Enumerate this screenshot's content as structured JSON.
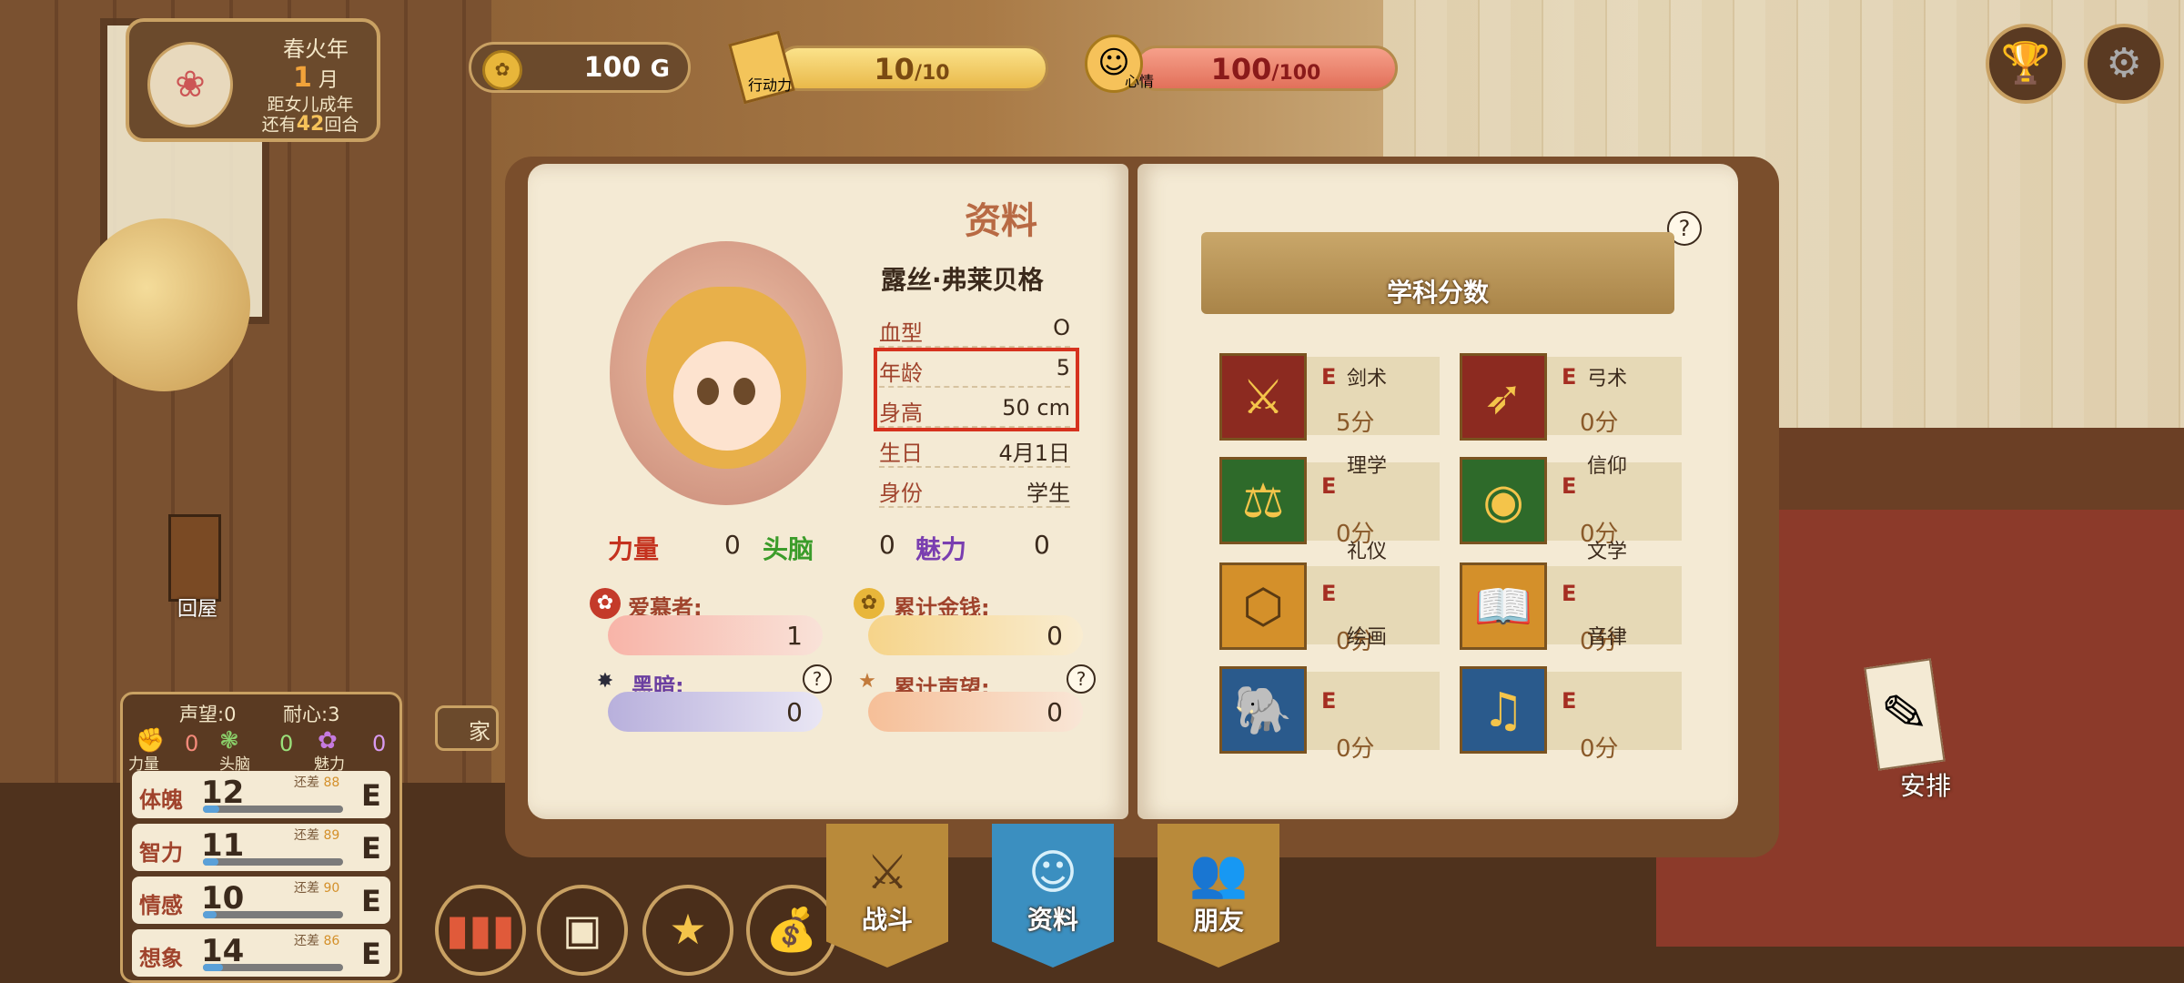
{
  "calendar": {
    "season": "春火年",
    "month_num": "1",
    "month_unit": "月",
    "line1": "距女儿成年",
    "line2_prefix": "还有",
    "rounds": "42",
    "line2_suffix": "回合"
  },
  "hud": {
    "gold": {
      "value": "100",
      "unit": "G"
    },
    "action": {
      "label": "行动力",
      "value": "10",
      "max": "/10",
      "fill": 1.0
    },
    "mood": {
      "label": "心情",
      "value": "100",
      "max": "/100",
      "fill": 1.0
    }
  },
  "buttons": {
    "trophy_icon": "trophy-icon",
    "settings_icon": "gear-icon",
    "back_home": "回屋",
    "home_tab": "家",
    "arrange": "安排"
  },
  "profile": {
    "title": "资料",
    "name": "露丝·弗莱贝格",
    "rows": [
      {
        "key": "血型",
        "value": "O"
      },
      {
        "key": "年龄",
        "value": "5"
      },
      {
        "key": "身高",
        "value": "50 cm"
      },
      {
        "key": "生日",
        "value": "4月1日"
      },
      {
        "key": "身份",
        "value": "学生"
      }
    ],
    "stats": [
      {
        "label": "力量",
        "value": "0",
        "color": "#c4321e"
      },
      {
        "label": "头脑",
        "value": "0",
        "color": "#3b9c2a"
      },
      {
        "label": "魅力",
        "value": "0",
        "color": "#7a3eb0"
      }
    ],
    "meters": [
      {
        "label": "爱慕者:",
        "value": "1",
        "color": "#f6c8bc",
        "icon": "rose-icon"
      },
      {
        "label": "累计金钱:",
        "value": "0",
        "color": "#f6dfae",
        "icon": "coin-icon"
      },
      {
        "label": "黑暗:",
        "value": "0",
        "color": "#cbc6e2",
        "icon": "dark-star-icon"
      },
      {
        "label": "累计声望:",
        "value": "0",
        "color": "#f6d2b6",
        "icon": "star-icon"
      }
    ]
  },
  "subjects": {
    "title": "学科分数",
    "items": [
      {
        "name": "剑术",
        "grade": "E",
        "score": "5分",
        "icon": "sword-icon",
        "color": "#8c2a20"
      },
      {
        "name": "弓术",
        "grade": "E",
        "score": "0分",
        "icon": "bow-icon",
        "color": "#8c2a20"
      },
      {
        "name": "理学",
        "grade": "E",
        "score": "0分",
        "icon": "scales-icon",
        "color": "#2e6a2a"
      },
      {
        "name": "信仰",
        "grade": "E",
        "score": "0分",
        "icon": "eye-icon",
        "color": "#2e6a2a"
      },
      {
        "name": "礼仪",
        "grade": "E",
        "score": "0分",
        "icon": "pendant-icon",
        "color": "#d4902a"
      },
      {
        "name": "文学",
        "grade": "E",
        "score": "0分",
        "icon": "book-icon",
        "color": "#d4902a"
      },
      {
        "name": "绘画",
        "grade": "E",
        "score": "0分",
        "icon": "elephant-icon",
        "color": "#2a5a8c"
      },
      {
        "name": "音律",
        "grade": "E",
        "score": "0分",
        "icon": "harp-icon",
        "color": "#2a5a8c"
      }
    ]
  },
  "side": {
    "reputation": "声望:0",
    "patience": "耐心:3",
    "mini": [
      {
        "label": "力量",
        "value": "0"
      },
      {
        "label": "头脑",
        "value": "0"
      },
      {
        "label": "魅力",
        "value": "0"
      }
    ],
    "remain_label": "还差",
    "attrs": [
      {
        "key": "体魄",
        "value": "12",
        "remain": "88",
        "grade": "E",
        "fill": 0.12
      },
      {
        "key": "智力",
        "value": "11",
        "remain": "89",
        "grade": "E",
        "fill": 0.11
      },
      {
        "key": "情感",
        "value": "10",
        "remain": "90",
        "grade": "E",
        "fill": 0.1
      },
      {
        "key": "想象",
        "value": "14",
        "remain": "86",
        "grade": "E",
        "fill": 0.14
      }
    ]
  },
  "nav": {
    "tabs": [
      {
        "label": "战斗",
        "icon": "crossed-swords-icon",
        "color": "#b98a3a"
      },
      {
        "label": "资料",
        "icon": "face-icon",
        "color": "#3b8fc0"
      },
      {
        "label": "朋友",
        "icon": "friends-icon",
        "color": "#b98a3a"
      }
    ]
  }
}
